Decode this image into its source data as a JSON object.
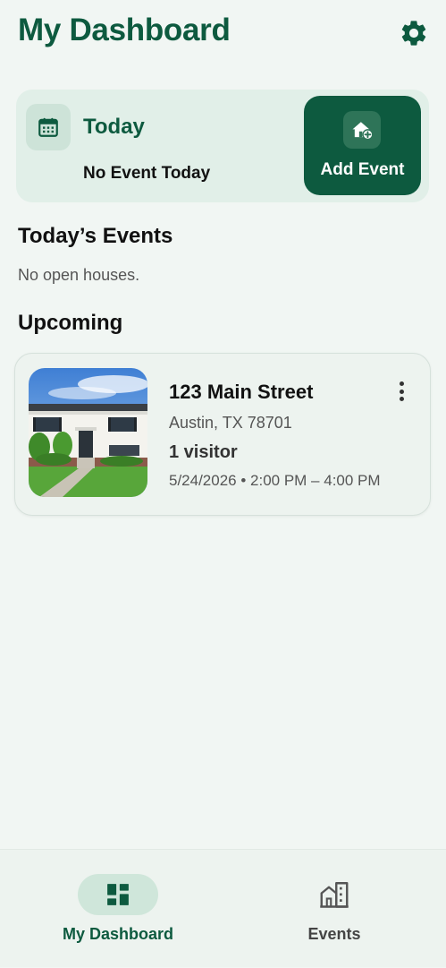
{
  "header": {
    "title": "My Dashboard",
    "settings_icon": "gear-icon"
  },
  "today_card": {
    "icon": "calendar-icon",
    "label": "Today",
    "status": "No Event Today",
    "add_button": {
      "icon": "add-house-icon",
      "label": "Add Event"
    }
  },
  "todays_events": {
    "heading": "Today’s Events",
    "empty_text": "No open houses."
  },
  "upcoming": {
    "heading": "Upcoming",
    "events": [
      {
        "address": "123 Main Street",
        "location": "Austin, TX 78701",
        "visitors": "1 visitor",
        "when": "5/24/2026 • 2:00 PM – 4:00 PM",
        "menu_icon": "more-vertical-icon"
      }
    ]
  },
  "bottom_nav": {
    "items": [
      {
        "label": "My Dashboard",
        "icon": "dashboard-icon",
        "active": true
      },
      {
        "label": "Events",
        "icon": "buildings-icon",
        "active": false
      }
    ]
  },
  "colors": {
    "brand": "#0d5a3f",
    "background": "#f1f6f3",
    "card": "#e1efe8",
    "nav_active_pill": "#cfe6da"
  }
}
